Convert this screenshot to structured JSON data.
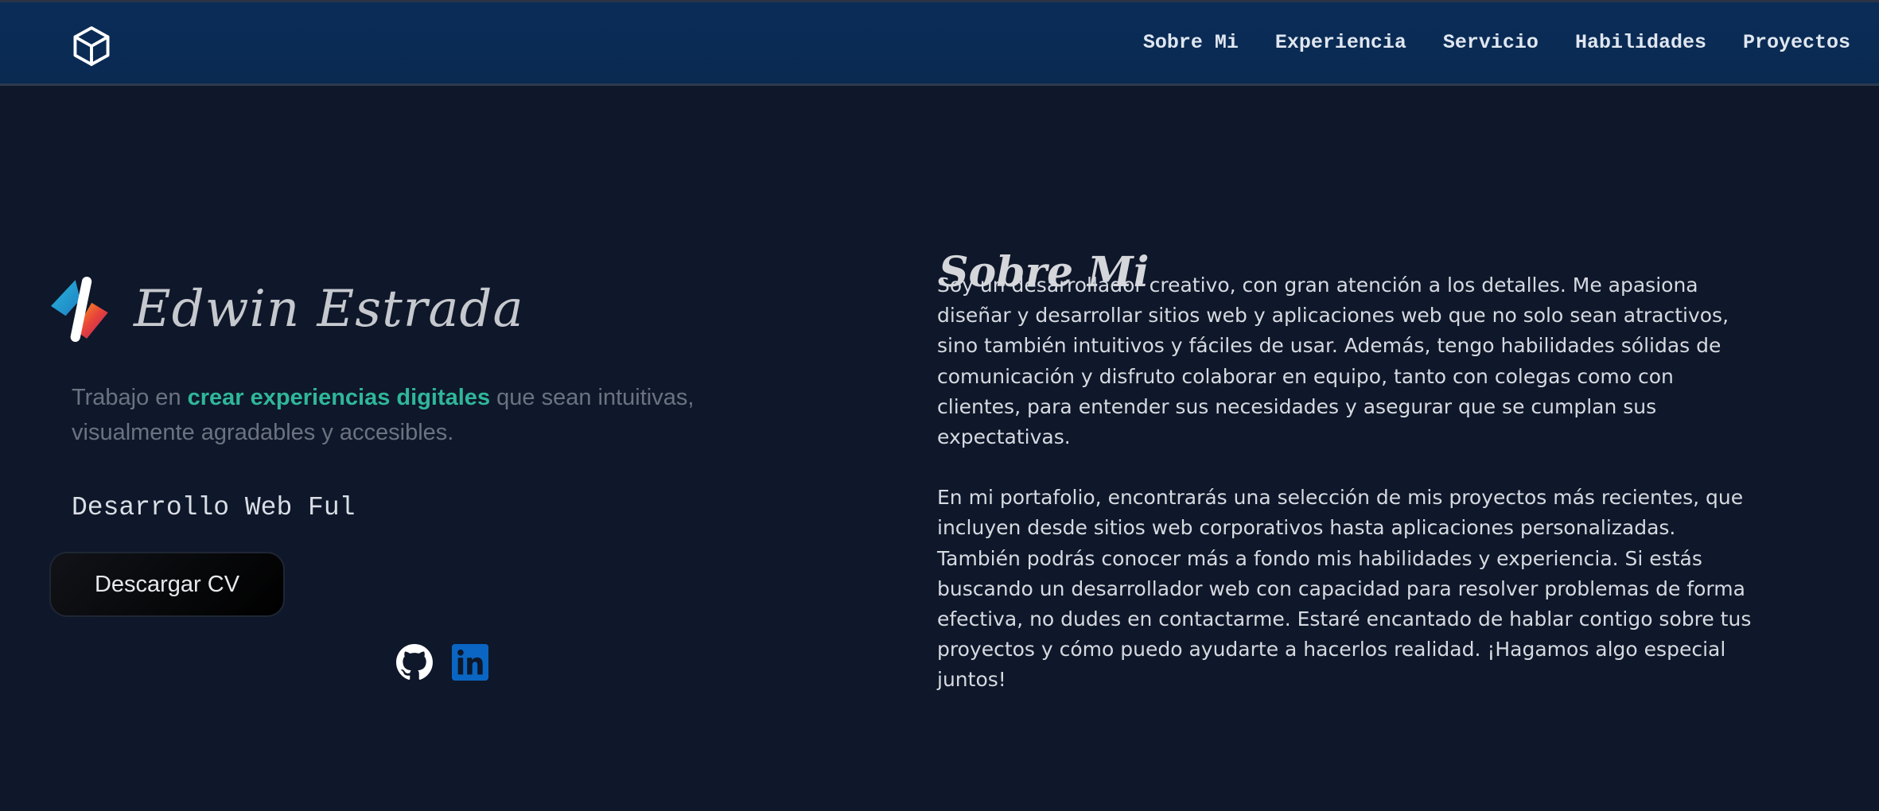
{
  "header": {
    "logo_icon": "cube-icon",
    "nav": [
      {
        "label": "Sobre Mi"
      },
      {
        "label": "Experiencia"
      },
      {
        "label": "Servicio"
      },
      {
        "label": "Habilidades"
      },
      {
        "label": "Proyectos"
      }
    ]
  },
  "hero": {
    "brand_icon": "code-slash-logo-icon",
    "name": "Edwin Estrada",
    "tagline_prefix": "Trabajo en ",
    "tagline_highlight": "crear experiencias digitales",
    "tagline_suffix": " que sean intuitivas, visualmente agradables y accesibles.",
    "typed_text": "Desarrollo Web Ful",
    "cv_button": "Descargar CV",
    "social": [
      {
        "icon": "github-icon",
        "color": "#ffffff"
      },
      {
        "icon": "linkedin-icon",
        "color": "#0a66c2"
      }
    ]
  },
  "about": {
    "title": "Sobre Mi",
    "paragraphs": [
      "Soy un desarrollador creativo, con gran atención a los detalles. Me apasiona diseñar y desarrollar sitios web y aplicaciones web que no solo sean atractivos, sino también intuitivos y fáciles de usar. Además, tengo habilidades sólidas de comunicación y disfruto colaborar en equipo, tanto con colegas como con clientes, para entender sus necesidades y asegurar que se cumplan sus expectativas.",
      "En mi portafolio, encontrarás una selección de mis proyectos más recientes, que incluyen desde sitios web corporativos hasta aplicaciones personalizadas. También podrás conocer más a fondo mis habilidades y experiencia. Si estás buscando un desarrollador web con capacidad para resolver problemas de forma efectiva, no dudes en contactarme. Estaré encantado de hablar contigo sobre tus proyectos y cómo puedo ayudarte a hacerlos realidad. ¡Hagamos algo especial juntos!"
    ]
  },
  "colors": {
    "background": "#0f172a",
    "header": "#0a2c57",
    "accent": "#2fb79a"
  }
}
